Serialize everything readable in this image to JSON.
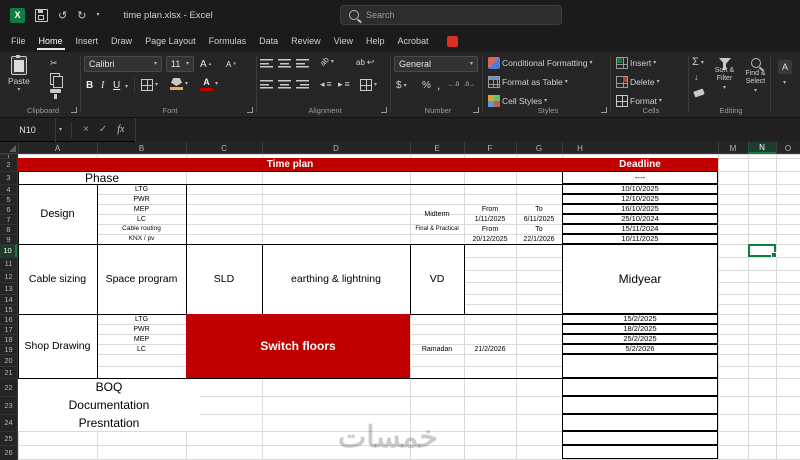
{
  "titlebar": {
    "title": "time plan.xlsx  -  Excel",
    "search_placeholder": "Search"
  },
  "tabs": {
    "items": [
      "File",
      "Home",
      "Insert",
      "Draw",
      "Page Layout",
      "Formulas",
      "Data",
      "Review",
      "View",
      "Help",
      "Acrobat"
    ],
    "active": "Home"
  },
  "ribbon": {
    "paste": "Paste",
    "bold": "B",
    "italic": "I",
    "underline": "U",
    "a_letter": "A",
    "font_name": "Calibri",
    "font_size": "11",
    "orientation": "ab",
    "wrap": "ab",
    "number_format": "General",
    "currency": "$",
    "percent": "%",
    "comma": ",",
    "dec_inc": "←.0",
    "dec_dec": ".0→",
    "conditional_formatting": "Conditional Formatting",
    "format_as_table": "Format as Table",
    "cell_styles": "Cell Styles",
    "insert": "Insert",
    "delete": "Delete",
    "format": "Format",
    "sort_filter": "Sort & Filter",
    "find_select": "Find & Select",
    "labels": {
      "clipboard": "Clipboard",
      "font": "Font",
      "alignment": "Alignment",
      "number": "Number",
      "styles": "Styles",
      "cells": "Cells",
      "editing": "Editing"
    }
  },
  "icons": {
    "excel": "X",
    "cut": "✂",
    "undo": "↺",
    "redo": "↻",
    "chevron": "▾",
    "chevron_up": "▴",
    "sum": "Σ",
    "close": "×",
    "check": "✓",
    "fill_down": "↓",
    "wrap_return": "↩",
    "indent_left": "◂",
    "indent_right": "▸",
    "lines": "≡"
  },
  "formula_bar": {
    "name_box": "N10",
    "fx": "fx"
  },
  "sheet": {
    "col_headers": [
      "A",
      "B",
      "C",
      "D",
      "E",
      "F",
      "G",
      "H",
      "M",
      "N",
      "O"
    ],
    "row_numbers": [
      "1",
      "2",
      "3",
      "4",
      "5",
      "6",
      "7",
      "8",
      "9",
      "10",
      "11",
      "12",
      "13",
      "14",
      "15",
      "16",
      "17",
      "18",
      "19",
      "20",
      "21",
      "22",
      "23",
      "24",
      "25",
      "26"
    ],
    "watermark": "خمسات",
    "cells": {
      "time_plan": "Time plan",
      "deadline": "Deadline",
      "phase": "Phase",
      "dash": "----",
      "design": "Design",
      "ltg": "LTG",
      "pwr": "PWR",
      "mep": "MEP",
      "lc": "LC",
      "cable_routing": "Cable routing",
      "knx": "KNX / pv",
      "midterm": "Midterm",
      "final_practical": "Final & Practical",
      "from": "From",
      "to": "To",
      "mid_from": "1/11/2025",
      "mid_to": "6/11/2025",
      "fin_from": "20/12/2025",
      "fin_to": "22/1/2026",
      "dl_r4": "10/10/2025",
      "dl_r5": "12/10/2025",
      "dl_r6": "16/10/2025",
      "dl_r7": "25/10/2024",
      "dl_r8": "15/11/2024",
      "dl_r9": "10/11/2025",
      "cable_sizing": "Cable sizing",
      "space_program": "Space program",
      "sld": "SLD",
      "earthing": "earthing & lightning",
      "vd": "VD",
      "midyear": "Midyear",
      "shop_drawing": "Shop Drawing",
      "switch_floors": "Switch floors",
      "ramadan": "Ramadan",
      "ramadan_date": "21/2/2026",
      "dl_r16": "15/2/2025",
      "dl_r17": "18/2/2025",
      "dl_r18": "25/2/2025",
      "dl_r19": "5/2/2026",
      "boq": "BOQ",
      "documentation": "Documentation",
      "presentation": "Presntation"
    }
  }
}
